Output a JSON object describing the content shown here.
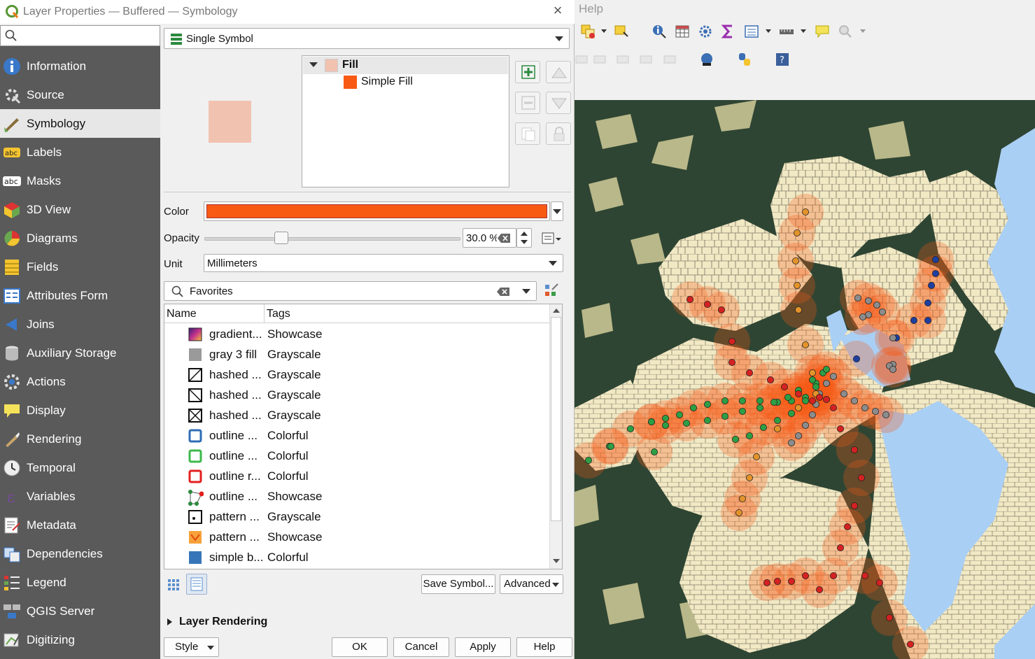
{
  "dialog": {
    "title": "Layer Properties — Buffered — Symbology",
    "close_glyph": "×"
  },
  "sidebar": {
    "search_placeholder": "",
    "items": [
      {
        "label": "Information",
        "icon": "info-icon"
      },
      {
        "label": "Source",
        "icon": "source-icon"
      },
      {
        "label": "Symbology",
        "icon": "symbology-icon",
        "active": true
      },
      {
        "label": "Labels",
        "icon": "labels-icon"
      },
      {
        "label": "Masks",
        "icon": "masks-icon"
      },
      {
        "label": "3D View",
        "icon": "cube-icon"
      },
      {
        "label": "Diagrams",
        "icon": "diagrams-icon"
      },
      {
        "label": "Fields",
        "icon": "fields-icon"
      },
      {
        "label": "Attributes Form",
        "icon": "form-icon"
      },
      {
        "label": "Joins",
        "icon": "joins-icon"
      },
      {
        "label": "Auxiliary Storage",
        "icon": "database-icon"
      },
      {
        "label": "Actions",
        "icon": "actions-icon"
      },
      {
        "label": "Display",
        "icon": "display-icon"
      },
      {
        "label": "Rendering",
        "icon": "brush-icon"
      },
      {
        "label": "Temporal",
        "icon": "clock-icon"
      },
      {
        "label": "Variables",
        "icon": "variables-icon"
      },
      {
        "label": "Metadata",
        "icon": "metadata-icon"
      },
      {
        "label": "Dependencies",
        "icon": "dependencies-icon"
      },
      {
        "label": "Legend",
        "icon": "legend-icon"
      },
      {
        "label": "QGIS Server",
        "icon": "server-icon"
      },
      {
        "label": "Digitizing",
        "icon": "digitizing-icon"
      }
    ]
  },
  "symbology": {
    "renderer": "Single Symbol",
    "tree": {
      "root": "Fill",
      "child": "Simple Fill"
    },
    "color_label": "Color",
    "fill_color": "#f85a14",
    "preview_color": "#f2c2b1",
    "opacity_label": "Opacity",
    "opacity_value": "30.0 %",
    "opacity_fraction": 0.3,
    "unit_label": "Unit",
    "unit_value": "Millimeters",
    "library_filter": "Favorites",
    "columns": {
      "name": "Name",
      "tags": "Tags"
    },
    "symbols": [
      {
        "name": "gradient...",
        "tags": "Showcase",
        "swatch": "gradient"
      },
      {
        "name": "gray 3 fill",
        "tags": "Grayscale",
        "swatch": "gray"
      },
      {
        "name": "hashed ...",
        "tags": "Grayscale",
        "swatch": "hash1"
      },
      {
        "name": "hashed ...",
        "tags": "Grayscale",
        "swatch": "hash2"
      },
      {
        "name": "hashed ...",
        "tags": "Grayscale",
        "swatch": "hash3"
      },
      {
        "name": "outline ...",
        "tags": "Colorful",
        "swatch": "outline-blue"
      },
      {
        "name": "outline ...",
        "tags": "Colorful",
        "swatch": "outline-green"
      },
      {
        "name": "outline r...",
        "tags": "Colorful",
        "swatch": "outline-red"
      },
      {
        "name": "outline ...",
        "tags": "Showcase",
        "swatch": "outline-nodes"
      },
      {
        "name": "pattern ...",
        "tags": "Grayscale",
        "swatch": "pattern-dot"
      },
      {
        "name": "pattern ...",
        "tags": "Showcase",
        "swatch": "pattern-orange"
      },
      {
        "name": "simple b...",
        "tags": "Colorful",
        "swatch": "simple-blue"
      }
    ],
    "save_symbol": "Save Symbol...",
    "advanced": "Advanced",
    "layer_rendering": "Layer Rendering"
  },
  "footer": {
    "style": "Style",
    "ok": "OK",
    "cancel": "Cancel",
    "apply": "Apply",
    "help": "Help"
  },
  "qgis": {
    "menu_help": "Help"
  },
  "map": {
    "land_dark": "#2f4533",
    "land_light": "#f1e8c4",
    "water": "#aacff4",
    "olive": "#b9b88a",
    "buffer": "#f85a14"
  }
}
